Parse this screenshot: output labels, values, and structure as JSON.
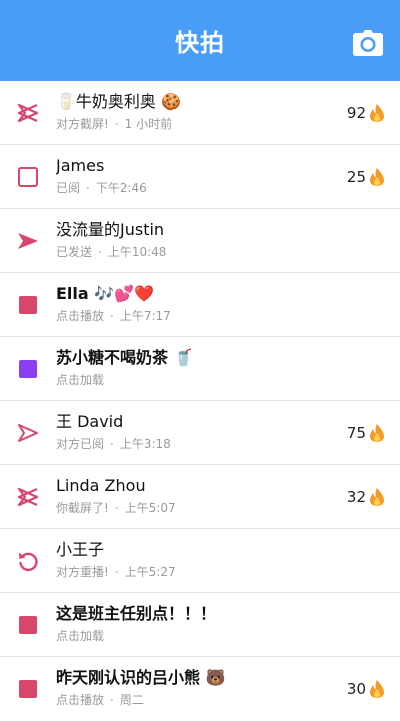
{
  "header": {
    "title": "快拍"
  },
  "colors": {
    "header": "#4a9df6",
    "red": "#d9456b",
    "purple": "#8a3ef0"
  },
  "rows": [
    {
      "name": "🥛牛奶奥利奥 🍪",
      "status": "对方截屏!",
      "time": "1 小时前",
      "streak": "92",
      "icon": "screenshot-icon"
    },
    {
      "name": "James",
      "status": "已阅",
      "time": "下午2:46",
      "streak": "25",
      "icon": "opened-square-icon"
    },
    {
      "name": "没流量的Justin",
      "status": "已发送",
      "time": "上午10:48",
      "streak": "",
      "icon": "sent-arrow-icon"
    },
    {
      "name": "Ella 🎶💕❤️",
      "status": "点击播放",
      "time": "上午7:17",
      "streak": "",
      "icon": "unopened-square-icon"
    },
    {
      "name": "苏小糖不喝奶茶 🥤",
      "status": "点击加载",
      "time": "",
      "streak": "",
      "icon": "unopened-purple-square-icon"
    },
    {
      "name": "王 David",
      "status": "对方已阅",
      "time": "上午3:18",
      "streak": "75",
      "icon": "opened-arrow-icon"
    },
    {
      "name": "Linda Zhou",
      "status": "你截屏了!",
      "time": "上午5:07",
      "streak": "32",
      "icon": "screenshot-icon"
    },
    {
      "name": "小王子",
      "status": "对方重播!",
      "time": "上午5:27",
      "streak": "",
      "icon": "replay-icon"
    },
    {
      "name": "这是班主任别点！！！",
      "status": "点击加载",
      "time": "",
      "streak": "",
      "icon": "unopened-square-icon"
    },
    {
      "name": "昨天刚认识的吕小熊 🐻",
      "status": "点击播放",
      "time": "周二",
      "streak": "30",
      "icon": "unopened-square-icon"
    }
  ]
}
